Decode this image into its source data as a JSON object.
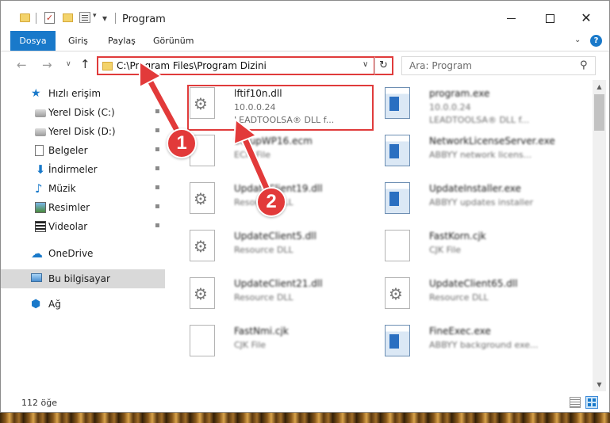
{
  "window": {
    "title": "Program",
    "minimize_symbol": "",
    "close_symbol": "✕"
  },
  "ribbon": {
    "tabs": [
      "Dosya",
      "Giriş",
      "Paylaş",
      "Görünüm"
    ],
    "help_symbol": "?",
    "expand_symbol": "⌄"
  },
  "nav": {
    "back_symbol": "←",
    "forward_symbol": "→",
    "history_symbol": "∨",
    "up_symbol": "↑",
    "address": "C:\\Program Files\\Program Dizini",
    "address_dropdown_symbol": "∨",
    "refresh_symbol": "↻",
    "search_placeholder": "Ara: Program",
    "search_symbol": "⚲"
  },
  "sidebar": {
    "items": [
      {
        "label": "Hızlı erişim",
        "icon": "star-icon"
      },
      {
        "label": "Yerel Disk (C:)",
        "icon": "disk-icon",
        "pinned": true
      },
      {
        "label": "Yerel Disk (D:)",
        "icon": "disk-icon",
        "pinned": true
      },
      {
        "label": "Belgeler",
        "icon": "documents-icon",
        "pinned": true
      },
      {
        "label": "İndirmeler",
        "icon": "download-icon",
        "pinned": true
      },
      {
        "label": "Müzik",
        "icon": "music-icon",
        "pinned": true
      },
      {
        "label": "Resimler",
        "icon": "pictures-icon",
        "pinned": true
      },
      {
        "label": "Videolar",
        "icon": "videos-icon",
        "pinned": true
      },
      {
        "label": "OneDrive",
        "icon": "cloud-icon"
      },
      {
        "label": "Bu bilgisayar",
        "icon": "computer-icon",
        "selected": true
      },
      {
        "label": "Ağ",
        "icon": "network-icon"
      }
    ],
    "pin_symbol": "📌",
    "star_symbol": "★",
    "download_symbol": "⬇",
    "music_symbol": "♪",
    "cloud_symbol": "☁",
    "network_symbol": "⬢"
  },
  "files": [
    {
      "name": "lftif10n.dll",
      "line2": "10.0.0.24",
      "line3": "LEADTOOLSA® DLL f...",
      "icon": "dll-icon"
    },
    {
      "name": "program.exe",
      "line2": "10.0.0.24",
      "line3": "LEADTOOLSA® DLL f...",
      "icon": "exe-icon"
    },
    {
      "name": "SetupWP16.ecm",
      "line2": "ECM File",
      "line3": "",
      "icon": "file-icon"
    },
    {
      "name": "NetworkLicenseServer.exe",
      "line2": "ABBYY network licens...",
      "line3": "",
      "icon": "exe-icon"
    },
    {
      "name": "UpdateClient19.dll",
      "line2": "Resource DLL",
      "line3": "",
      "icon": "dll-icon"
    },
    {
      "name": "UpdateInstaller.exe",
      "line2": "ABBYY updates installer",
      "line3": "",
      "icon": "exe-icon"
    },
    {
      "name": "UpdateClient5.dll",
      "line2": "Resource DLL",
      "line3": "",
      "icon": "dll-icon"
    },
    {
      "name": "FastKorn.cjk",
      "line2": "CJK File",
      "line3": "",
      "icon": "file-icon"
    },
    {
      "name": "UpdateClient21.dll",
      "line2": "Resource DLL",
      "line3": "",
      "icon": "dll-icon"
    },
    {
      "name": "UpdateClient65.dll",
      "line2": "Resource DLL",
      "line3": "",
      "icon": "dll-icon"
    },
    {
      "name": "FastNmi.cjk",
      "line2": "CJK File",
      "line3": "",
      "icon": "file-icon"
    },
    {
      "name": "FineExec.exe",
      "line2": "ABBYY background exe...",
      "line3": "",
      "icon": "exe-icon"
    }
  ],
  "status": {
    "item_count": "112 öğe"
  },
  "scrollbar": {
    "up_symbol": "▲",
    "down_symbol": "▼"
  },
  "annotations": {
    "badge1": "1",
    "badge2": "2",
    "accent": "#e03b3b"
  }
}
